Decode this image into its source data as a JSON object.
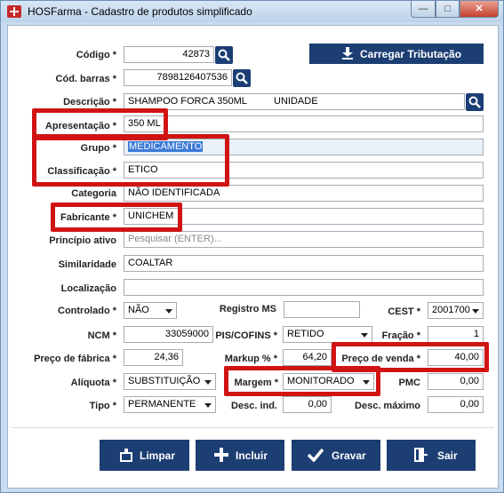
{
  "window": {
    "title": "HOSFarma - Cadastro de produtos simplificado",
    "controls": {
      "minimize": "—",
      "maximize": "□",
      "close": "✕"
    }
  },
  "colors": {
    "button_bg": "#1c3e73",
    "highlight_border": "#d01414",
    "selection": "#3b7ad7"
  },
  "form": {
    "codigo": {
      "label": "Código *",
      "value": "42873"
    },
    "cod_barras": {
      "label": "Cód. barras *",
      "value": "7898126407536"
    },
    "carregar_tributacao": "Carregar Tributação",
    "descricao": {
      "label": "Descrição *",
      "value": "SHAMPOO FORCA 350ML          UNIDADE"
    },
    "apresentacao": {
      "label": "Apresentação *",
      "value": "350 ML"
    },
    "grupo": {
      "label": "Grupo *",
      "value": "MEDICAMENTO"
    },
    "classificacao": {
      "label": "Classificação *",
      "value": "ETICO"
    },
    "categoria": {
      "label": "Categoria",
      "value": "NÃO IDENTIFICADA"
    },
    "fabricante": {
      "label": "Fabricante *",
      "value": "UNICHEM"
    },
    "principio_ativo": {
      "label": "Princípio ativo",
      "placeholder": "Pesquisar (ENTER)..."
    },
    "similaridade": {
      "label": "Similaridade",
      "value": "COALTAR"
    },
    "localizacao": {
      "label": "Localização",
      "value": ""
    },
    "controlado": {
      "label": "Controlado *",
      "value": "NÃO"
    },
    "registro_ms": {
      "label": "Registro MS",
      "value": ""
    },
    "cest": {
      "label": "CEST *",
      "value": "2001700"
    },
    "ncm": {
      "label": "NCM *",
      "value": "33059000"
    },
    "pis_cofins": {
      "label": "PIS/COFINS *",
      "value": "RETIDO"
    },
    "fracao": {
      "label": "Fração *",
      "value": "1"
    },
    "preco_fabrica": {
      "label": "Preço de fábrica *",
      "value": "24,36"
    },
    "markup": {
      "label": "Markup % *",
      "value": "64,20"
    },
    "preco_venda": {
      "label": "Preço de venda *",
      "value": "40,00"
    },
    "aliquota": {
      "label": "Alíquota *",
      "value": "SUBSTITUIÇÃO"
    },
    "margem": {
      "label": "Margem *",
      "value": "MONITORADO"
    },
    "pmc": {
      "label": "PMC",
      "value": "0,00"
    },
    "tipo": {
      "label": "Tipo *",
      "value": "PERMANENTE"
    },
    "desc_ind": {
      "label": "Desc. ind.",
      "value": "0,00"
    },
    "desc_maximo": {
      "label": "Desc. máximo",
      "value": "0,00"
    }
  },
  "buttons": {
    "limpar": "Limpar",
    "incluir": "Incluir",
    "gravar": "Gravar",
    "sair": "Sair"
  }
}
